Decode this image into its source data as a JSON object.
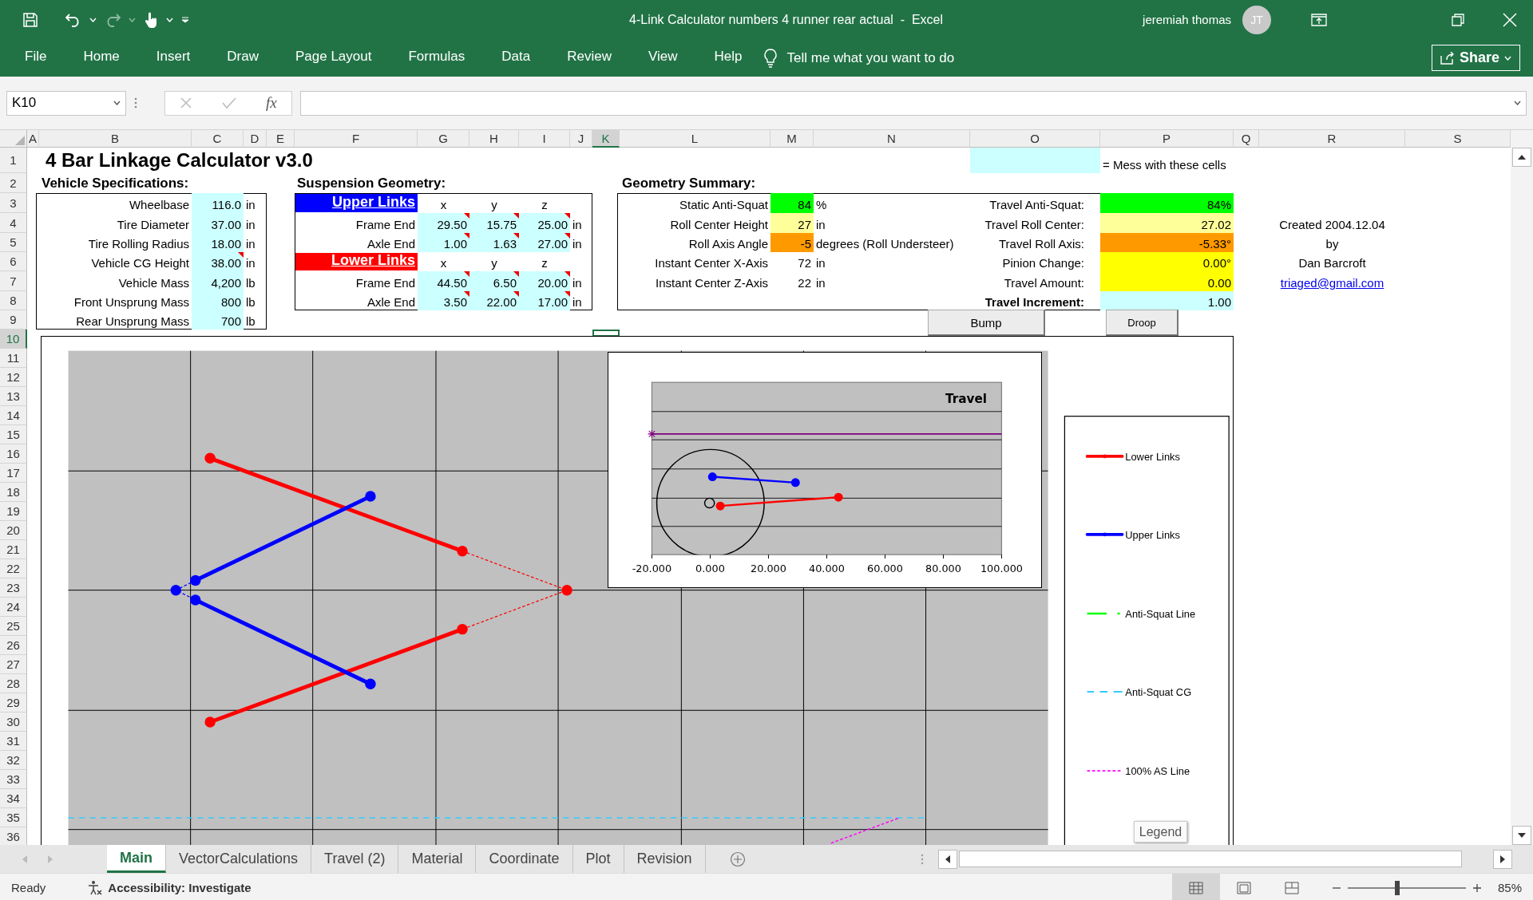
{
  "title_bar": {
    "title": "4-Link Calculator numbers 4 runner rear actual  -  Excel",
    "user": "jeremiah thomas",
    "avatar": "JT"
  },
  "ribbon_tabs": [
    {
      "label": "File",
      "selected": false
    },
    {
      "label": "Home",
      "selected": false
    },
    {
      "label": "Insert",
      "selected": false
    },
    {
      "label": "Draw",
      "selected": false
    },
    {
      "label": "Page Layout",
      "selected": false
    },
    {
      "label": "Formulas",
      "selected": false
    },
    {
      "label": "Data",
      "selected": false
    },
    {
      "label": "Review",
      "selected": false
    },
    {
      "label": "View",
      "selected": false
    },
    {
      "label": "Help",
      "selected": false
    }
  ],
  "tell_me": "Tell me what you want to do",
  "share": "Share",
  "formula_bar": {
    "name_box": "K10",
    "fx": "fx"
  },
  "sheet": {
    "columns": [
      {
        "label": "A",
        "selected": false
      },
      {
        "label": "B",
        "selected": false
      },
      {
        "label": "C",
        "selected": false
      },
      {
        "label": "D",
        "selected": false
      },
      {
        "label": "E",
        "selected": false
      },
      {
        "label": "F",
        "selected": false
      },
      {
        "label": "G",
        "selected": false
      },
      {
        "label": "H",
        "selected": false
      },
      {
        "label": "I",
        "selected": false
      },
      {
        "label": "J",
        "selected": false
      },
      {
        "label": "K",
        "selected": true
      },
      {
        "label": "L",
        "selected": false
      },
      {
        "label": "M",
        "selected": false
      },
      {
        "label": "N",
        "selected": false
      },
      {
        "label": "O",
        "selected": false
      },
      {
        "label": "P",
        "selected": false
      },
      {
        "label": "Q",
        "selected": false
      },
      {
        "label": "R",
        "selected": false
      },
      {
        "label": "S",
        "selected": false
      }
    ],
    "rows": [
      {
        "label": "1",
        "selected": false
      },
      {
        "label": "2",
        "selected": false
      },
      {
        "label": "3",
        "selected": false
      },
      {
        "label": "4",
        "selected": false
      },
      {
        "label": "5",
        "selected": false
      },
      {
        "label": "6",
        "selected": false
      },
      {
        "label": "7",
        "selected": false
      },
      {
        "label": "8",
        "selected": false
      },
      {
        "label": "9",
        "selected": false
      },
      {
        "label": "10",
        "selected": true
      },
      {
        "label": "11",
        "selected": false
      },
      {
        "label": "12",
        "selected": false
      },
      {
        "label": "13",
        "selected": false
      },
      {
        "label": "14",
        "selected": false
      },
      {
        "label": "15",
        "selected": false
      },
      {
        "label": "16",
        "selected": false
      },
      {
        "label": "17",
        "selected": false
      },
      {
        "label": "18",
        "selected": false
      },
      {
        "label": "19",
        "selected": false
      },
      {
        "label": "20",
        "selected": false
      },
      {
        "label": "21",
        "selected": false
      },
      {
        "label": "22",
        "selected": false
      },
      {
        "label": "23",
        "selected": false
      },
      {
        "label": "24",
        "selected": false
      },
      {
        "label": "25",
        "selected": false
      },
      {
        "label": "26",
        "selected": false
      },
      {
        "label": "27",
        "selected": false
      },
      {
        "label": "28",
        "selected": false
      },
      {
        "label": "29",
        "selected": false
      },
      {
        "label": "30",
        "selected": false
      },
      {
        "label": "31",
        "selected": false
      },
      {
        "label": "32",
        "selected": false
      },
      {
        "label": "33",
        "selected": false
      },
      {
        "label": "34",
        "selected": false
      },
      {
        "label": "35",
        "selected": false
      },
      {
        "label": "36",
        "selected": false
      }
    ]
  },
  "title": "4 Bar Linkage Calculator v3.0",
  "key_note": {
    "text": "= Mess with these cells",
    "color": "#ccffff"
  },
  "vehicle_specs": {
    "heading": "Vehicle Specifications:",
    "rows": [
      {
        "label": "Wheelbase",
        "value": "116.0",
        "unit": "in",
        "comment": false
      },
      {
        "label": "Tire Diameter",
        "value": "37.00",
        "unit": "in",
        "comment": false
      },
      {
        "label": "Tire Rolling Radius",
        "value": "18.00",
        "unit": "in",
        "comment": false
      },
      {
        "label": "Vehicle CG Height",
        "value": "38.00",
        "unit": "in",
        "comment": true
      },
      {
        "label": "Vehicle Mass",
        "value": "4,200",
        "unit": "lb",
        "comment": false
      },
      {
        "label": "Front Unsprung Mass",
        "value": "800",
        "unit": "lb",
        "comment": false
      },
      {
        "label": "Rear Unsprung Mass",
        "value": "700",
        "unit": "lb",
        "comment": false
      }
    ]
  },
  "suspension_geometry": {
    "heading": "Suspension Geometry:",
    "groups": [
      {
        "name": "Upper Links",
        "color": "#0000ff",
        "axes": [
          "x",
          "y",
          "z"
        ],
        "rows": [
          {
            "label": "Frame End",
            "unit": "in",
            "values": [
              {
                "text": "29.50",
                "comment": true
              },
              {
                "text": "15.75",
                "comment": true
              },
              {
                "text": "25.00",
                "comment": true
              }
            ]
          },
          {
            "label": "Axle End",
            "unit": "in",
            "values": [
              {
                "text": "1.00",
                "comment": true
              },
              {
                "text": "1.63",
                "comment": true
              },
              {
                "text": "27.00",
                "comment": true
              }
            ]
          }
        ]
      },
      {
        "name": "Lower Links",
        "color": "#ff0000",
        "axes": [
          "x",
          "y",
          "z"
        ],
        "rows": [
          {
            "label": "Frame End",
            "unit": "in",
            "values": [
              {
                "text": "44.50",
                "comment": true
              },
              {
                "text": "6.50",
                "comment": true
              },
              {
                "text": "20.00",
                "comment": true
              }
            ]
          },
          {
            "label": "Axle End",
            "unit": "in",
            "values": [
              {
                "text": "3.50",
                "comment": true
              },
              {
                "text": "22.00",
                "comment": true
              },
              {
                "text": "17.00",
                "comment": true
              }
            ]
          }
        ]
      }
    ]
  },
  "geometry_summary": {
    "heading": "Geometry Summary:",
    "left": [
      {
        "label": "Static Anti-Squat",
        "value": "84",
        "unit": "%",
        "color": "#00ff00"
      },
      {
        "label": "Roll Center Height",
        "value": "27",
        "unit": "in",
        "color": "#ffff99"
      },
      {
        "label": "Roll Axis Angle",
        "value": "-5",
        "unit": "degrees (Roll Understeer)",
        "color": "#ff9900"
      },
      {
        "label": "Instant Center X-Axis",
        "value": "72",
        "unit": "in"
      },
      {
        "label": "Instant Center Z-Axis",
        "value": "22",
        "unit": "in"
      }
    ],
    "right": [
      {
        "label": "Travel Anti-Squat:",
        "value": "84%",
        "color": "#00ff00",
        "bold": false
      },
      {
        "label": "Travel Roll Center:",
        "value": "27.02",
        "color": "#ffff99",
        "bold": false
      },
      {
        "label": "Travel Roll Axis:",
        "value": "-5.33°",
        "color": "#ff9900",
        "bold": false
      },
      {
        "label": "Pinion Change:",
        "value": "0.00°",
        "color": "#ffff00",
        "bold": false
      },
      {
        "label": "Travel Amount:",
        "value": "0.00",
        "color": "#ffff00",
        "bold": false
      },
      {
        "label": "Travel Increment:",
        "value": "1.00",
        "color": "#ccffff",
        "bold": true
      }
    ]
  },
  "credits": [
    "Created 2004.12.04",
    "by",
    "Dan Barcroft"
  ],
  "email": "triaged@gmail.com",
  "buttons": [
    "Bump",
    "Droop"
  ],
  "main_chart": {
    "legend": [
      {
        "label": "Lower Links",
        "color": "#ff0000",
        "kind": "solid"
      },
      {
        "label": "Upper Links",
        "color": "#0000ff",
        "kind": "solid"
      },
      {
        "label": "Anti-Squat Line",
        "color": "#00ff00",
        "kind": "dash_dot"
      },
      {
        "label": "Anti-Squat CG",
        "color": "#33ccff",
        "kind": "dashed"
      },
      {
        "label": "100% AS Line",
        "color": "#ff00ff",
        "kind": "dotted"
      }
    ],
    "tooltip": "Legend"
  },
  "inset_chart": {
    "title": "Travel",
    "x_tick_labels": [
      "-20.000",
      "0.000",
      "20.000",
      "40.000",
      "60.000",
      "80.000",
      "100.000"
    ]
  },
  "sheet_tabs": [
    {
      "label": "Main",
      "selected": true
    },
    {
      "label": "VectorCalculations",
      "selected": false
    },
    {
      "label": "Travel (2)",
      "selected": false
    },
    {
      "label": "Material",
      "selected": false
    },
    {
      "label": "Coordinate",
      "selected": false
    },
    {
      "label": "Plot",
      "selected": false
    },
    {
      "label": "Revision",
      "selected": false
    }
  ],
  "status_bar": {
    "status": "Ready",
    "accessibility": "Accessibility: Investigate",
    "views": [
      {
        "kind": "normal",
        "selected": true
      },
      {
        "kind": "page_layout",
        "selected": false
      },
      {
        "kind": "page_break",
        "selected": false
      }
    ],
    "zoom": {
      "level": 0.42,
      "reading": "85%"
    }
  }
}
